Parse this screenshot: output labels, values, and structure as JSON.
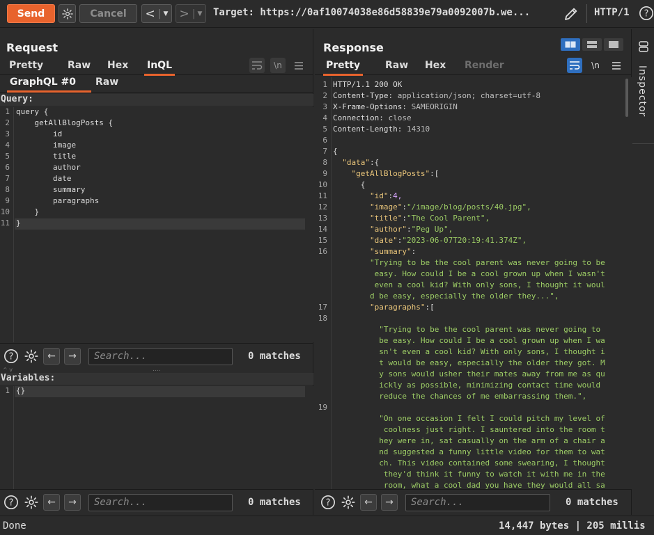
{
  "toolbar": {
    "send_label": "Send",
    "cancel_label": "Cancel",
    "back_label": "<",
    "forward_label": ">",
    "target": "Target: https://0af10074038e86d58839e79a0092007b.we...",
    "http_version": "HTTP/1"
  },
  "request": {
    "title": "Request",
    "tabs": [
      "Pretty",
      "Raw",
      "Hex",
      "InQL"
    ],
    "active_tab": "InQL",
    "subtabs": [
      "GraphQL #0",
      "Raw"
    ],
    "query_label": "Query:",
    "query_lines": [
      "query {",
      "    getAllBlogPosts {",
      "        id",
      "        image",
      "        title",
      "        author",
      "        date",
      "        summary",
      "        paragraphs",
      "    }",
      "}"
    ],
    "variables_label": "Variables:",
    "variables_lines": [
      "{}"
    ],
    "search1": {
      "placeholder": "Search...",
      "count": "0 matches"
    },
    "search2": {
      "placeholder": "Search...",
      "count": "0 matches"
    }
  },
  "response": {
    "title": "Response",
    "tabs": [
      "Pretty",
      "Raw",
      "Hex",
      "Render"
    ],
    "active_tab": "Pretty",
    "lines": [
      {
        "n": "1",
        "t": "HTTP/1.1 200 OK"
      },
      {
        "n": "2",
        "t": "Content-Type: application/json; charset=utf-8"
      },
      {
        "n": "3",
        "t": "X-Frame-Options: SAMEORIGIN"
      },
      {
        "n": "4",
        "t": "Connection: close"
      },
      {
        "n": "5",
        "t": "Content-Length: 14310"
      },
      {
        "n": "6",
        "t": ""
      },
      {
        "n": "7",
        "t": "{"
      },
      {
        "n": "8",
        "t": "  \"data\":{"
      },
      {
        "n": "9",
        "t": "    \"getAllBlogPosts\":["
      },
      {
        "n": "10",
        "t": "      {"
      },
      {
        "n": "11",
        "t": "        \"id\":4,"
      },
      {
        "n": "12",
        "t": "        \"image\":\"/image/blog/posts/40.jpg\","
      },
      {
        "n": "13",
        "t": "        \"title\":\"The Cool Parent\","
      },
      {
        "n": "14",
        "t": "        \"author\":\"Peg Up\","
      },
      {
        "n": "15",
        "t": "        \"date\":\"2023-06-07T20:19:41.374Z\","
      },
      {
        "n": "16",
        "t": "        \"summary\":"
      },
      {
        "n": "",
        "t": "        \"Trying to be the cool parent was never going to be"
      },
      {
        "n": "",
        "t": "         easy. How could I be a cool grown up when I wasn't"
      },
      {
        "n": "",
        "t": "         even a cool kid? With only sons, I thought it woul"
      },
      {
        "n": "",
        "t": "        d be easy, especially the older they...\","
      },
      {
        "n": "17",
        "t": "        \"paragraphs\":["
      },
      {
        "n": "18",
        "t": ""
      },
      {
        "n": "",
        "t": "          \"Trying to be the cool parent was never going to"
      },
      {
        "n": "",
        "t": "          be easy. How could I be a cool grown up when I wa"
      },
      {
        "n": "",
        "t": "          sn't even a cool kid? With only sons, I thought i"
      },
      {
        "n": "",
        "t": "          t would be easy, especially the older they got. M"
      },
      {
        "n": "",
        "t": "          y sons would usher their mates away from me as qu"
      },
      {
        "n": "",
        "t": "          ickly as possible, minimizing contact time would"
      },
      {
        "n": "",
        "t": "          reduce the chances of me embarrassing them.\","
      },
      {
        "n": "19",
        "t": ""
      },
      {
        "n": "",
        "t": "          \"On one occasion I felt I could pitch my level of"
      },
      {
        "n": "",
        "t": "           coolness just right. I sauntered into the room t"
      },
      {
        "n": "",
        "t": "          hey were in, sat casually on the arm of a chair a"
      },
      {
        "n": "",
        "t": "          nd suggested a funny little video for them to wat"
      },
      {
        "n": "",
        "t": "          ch. This video contained some swearing, I thought"
      },
      {
        "n": "",
        "t": "           they'd think it funny to watch it with me in the"
      },
      {
        "n": "",
        "t": "           room, what a cool dad you have they would all sa"
      }
    ],
    "search": {
      "placeholder": "Search...",
      "count": "0 matches"
    }
  },
  "inspector": {
    "label": "Inspector"
  },
  "status": {
    "left": "Done",
    "right": "14,447 bytes | 205 millis"
  },
  "colors": {
    "accent": "#e8632d",
    "background": "#2b2b2b",
    "json_string": "#9ccc65",
    "json_key": "#e9c57a"
  }
}
